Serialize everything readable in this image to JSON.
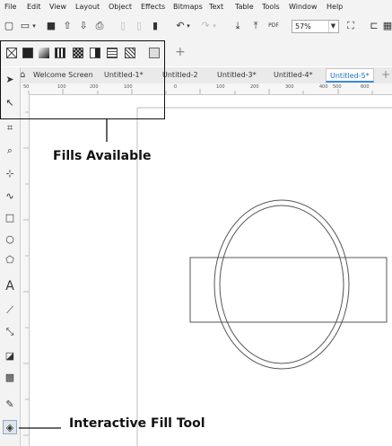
{
  "menu": [
    "File",
    "Edit",
    "View",
    "Layout",
    "Object",
    "Effects",
    "Bitmaps",
    "Text",
    "Table",
    "Tools",
    "Window",
    "Help"
  ],
  "toolbar": {
    "zoom_value": "57%"
  },
  "tabs": [
    "Welcome Screen",
    "Untitled-1*",
    "Untitled-2",
    "Untitled-3*",
    "Untitled-4*",
    "Untitled-5*"
  ],
  "active_tab_index": 5,
  "tab_plus": "+",
  "propbar_plus": "+",
  "ruler_labels": [
    "50",
    "100",
    "200",
    "100",
    "0",
    "100",
    "200",
    "300",
    "400",
    "500",
    "600"
  ],
  "annotations": {
    "fills_label": "Fills Available",
    "tool_label": "Interactive Fill Tool"
  },
  "fill_types": [
    "no-fill",
    "uniform-fill",
    "fountain-fill",
    "vector-pattern-fill",
    "bitmap-pattern-fill",
    "two-color-pattern-fill",
    "texture-fill",
    "postscript-fill",
    "fill-merge"
  ],
  "colors": {
    "accent": "#3d8ad9",
    "tab_text_active": "#1e6fb8"
  }
}
